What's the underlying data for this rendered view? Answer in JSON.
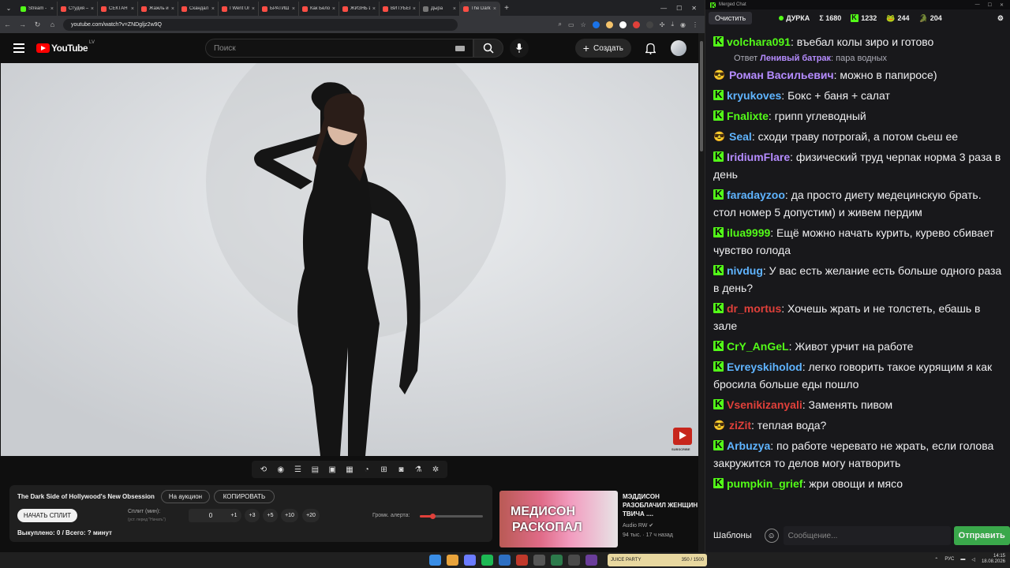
{
  "browser": {
    "tabs": [
      {
        "label": "Stream - K",
        "color": "#53fc18",
        "active": false
      },
      {
        "label": "Студия —",
        "color": "#ff4e45",
        "active": false
      },
      {
        "label": "СЕКТАНТЫ",
        "color": "#ff4e45",
        "active": false
      },
      {
        "label": "Жажль и",
        "color": "#ff4e45",
        "active": false
      },
      {
        "label": "Скандал с",
        "color": "#ff4e45",
        "active": false
      },
      {
        "label": "I Went Un",
        "color": "#ff4e45",
        "active": false
      },
      {
        "label": "БРАТИШК",
        "color": "#ff4e45",
        "active": false
      },
      {
        "label": "Как Белор",
        "color": "#ff4e45",
        "active": false
      },
      {
        "label": "ЖИЗНЬ И",
        "color": "#ff4e45",
        "active": false
      },
      {
        "label": "ВИТУБЕРЫ",
        "color": "#ff4e45",
        "active": false
      },
      {
        "label": "Дыра",
        "color": "#777777",
        "active": false
      },
      {
        "label": "The Dark",
        "color": "#ff4e45",
        "active": true
      }
    ],
    "url": "youtube.com/watch?v=ZNDgljz2w9Q"
  },
  "youtube": {
    "logo_text": "YouTube",
    "country": "LV",
    "search_placeholder": "Поиск",
    "create_label": "Создать",
    "watermark": "SUBSCRIBE"
  },
  "panel": {
    "title": "The Dark Side of Hollywood's New Obsession",
    "auction_label": "На аукцион",
    "copy_label": "КОПИРОВАТЬ",
    "start_label": "НАЧАТЬ СПЛИТ",
    "split_label": "Сплит (мин):",
    "split_hint": "(уст. перед \"Начать\")",
    "split_value": "0",
    "increments": [
      "+1",
      "+3",
      "+5",
      "+10",
      "+20"
    ],
    "volume_label": "Громк. алерта:",
    "volume_level": 0.2,
    "status": "Выкуплено: 0 / Всего: ? минут"
  },
  "recommendation": {
    "thumb_line1": "МЕДИСОН",
    "thumb_line2": "РАСКОПАЛ",
    "title": "МЭДДИСОН РАЗОБЛАЧИЛ ЖЕНЩИН ТВИЧА ....",
    "channel": "Audio RW",
    "views": "94 тыс.",
    "age": "17 ч назад"
  },
  "chat": {
    "window_title": "Merged Chat",
    "clear_label": "Очистить",
    "channel": "ДУРКА",
    "viewers_total": "Σ 1680",
    "viewers_kick": "1232",
    "viewers_a": "244",
    "viewers_b": "204",
    "messages": [
      {
        "user": "volchara091",
        "color": "#53fc18",
        "text": "въебал колы зиро и готово",
        "badge": "kick"
      },
      {
        "user": "Роман Васильевич",
        "color": "#b58cff",
        "text": "можно в папиросе)",
        "badge": "gift"
      },
      {
        "user": "kryukoves",
        "color": "#5fb4ff",
        "text": "Бокс + баня + салат",
        "badge": "kick"
      },
      {
        "user": "Fnalixte",
        "color": "#53fc18",
        "text": "грипп углеводный",
        "badge": "kick"
      },
      {
        "user": "Seal",
        "color": "#5fb4ff",
        "text": "сходи траву потрогай, а потом сьеш ее",
        "badge": "gift"
      },
      {
        "user": "IridiumFlare",
        "color": "#b58cff",
        "text": "физический труд черпак норма 3 раза в день",
        "badge": "kick"
      },
      {
        "user": "faradayzoo",
        "color": "#5fb4ff",
        "text": "да просто диету медецинскую брать. стол номер 5 допустим) и живем пердим",
        "badge": "kick"
      },
      {
        "user": "ilua9999",
        "color": "#53fc18",
        "text": "Ещё можно начать курить, курево сбивает чувство голода",
        "badge": "kick"
      },
      {
        "user": "nivdug",
        "color": "#5fb4ff",
        "text": "У вас есть желание есть больше одного раза в день?",
        "badge": "kick"
      },
      {
        "user": "dr_mortus",
        "color": "#e0403a",
        "text": "Хочешь жрать и не толстеть, ебашь в зале",
        "badge": "kick"
      },
      {
        "user": "CrY_AnGeL",
        "color": "#53fc18",
        "text": "Живот урчит на работе",
        "badge": "kick"
      },
      {
        "user": "Evreyskiholod",
        "color": "#5fb4ff",
        "text": "легко говорить такое курящим я как бросила больше еды пошло",
        "badge": "kick"
      },
      {
        "user": "Vsenikizanyali",
        "color": "#e0403a",
        "text": "Заменять пивом",
        "badge": "kick"
      },
      {
        "user": "ziZit",
        "color": "#e0403a",
        "text": "теплая вода?",
        "badge": "gift"
      },
      {
        "user": "Arbuzya",
        "color": "#5fb4ff",
        "text": "по работе черевато не жрать, если голова закружится то делов могу натворить",
        "badge": "kick"
      },
      {
        "user": "pumpkin_grief",
        "color": "#53fc18",
        "text": "жри овощи и мясо",
        "badge": "kick"
      }
    ],
    "reply": {
      "prefix": "Ответ",
      "user": "Ленивый батрак",
      "text": "пара водных"
    },
    "templates_label": "Шаблоны",
    "input_placeholder": "Сообщение...",
    "send_label": "Отправить"
  },
  "taskbar": {
    "widget_text": "JUICE PARTY",
    "widget_count": "350 / 1500",
    "lang": "РУС",
    "time": "14:15",
    "date": "18.08.2026"
  }
}
